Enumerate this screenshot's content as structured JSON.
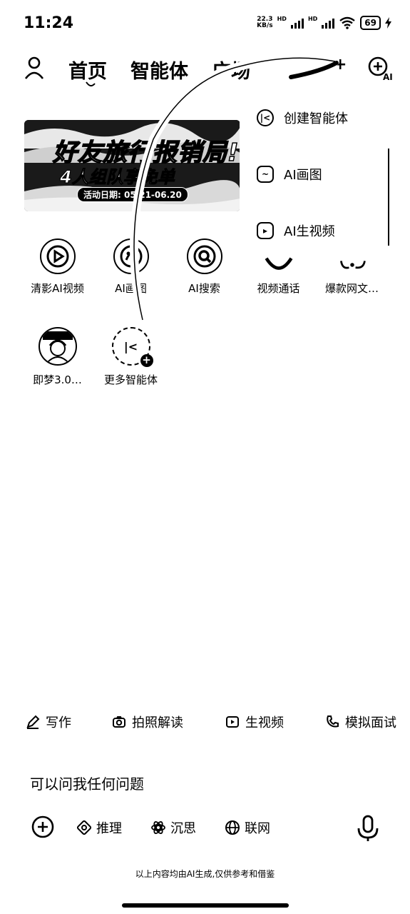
{
  "status": {
    "time": "11:24",
    "net_speed_value": "22.3",
    "net_speed_unit": "KB/s",
    "hd_label": "HD",
    "battery": "69"
  },
  "nav": {
    "tabs": [
      "首页",
      "智能体",
      "广场"
    ],
    "plus": "+"
  },
  "banner": {
    "title": "好友旅行报销局!",
    "subtitle": "4人组队享免单",
    "date": "活动日期: 05.21-06.20"
  },
  "menu": {
    "items": [
      {
        "label": "创建智能体",
        "icon": "agent-create-icon"
      },
      {
        "label": "AI画图",
        "icon": "image-icon"
      },
      {
        "label": "AI生视频",
        "icon": "video-icon"
      }
    ]
  },
  "agents": [
    {
      "label": "清影AI视频",
      "icon": "play-icon"
    },
    {
      "label": "AI画图",
      "icon": "paint-icon"
    },
    {
      "label": "AI搜索",
      "icon": "search-icon"
    },
    {
      "label": "视频通话",
      "icon": "video-call-icon"
    },
    {
      "label": "爆款网文…",
      "icon": "book-icon"
    },
    {
      "label": "即梦3.0…",
      "icon": "avatar-icon"
    },
    {
      "label": "更多智能体",
      "icon": "more-agents-icon"
    }
  ],
  "chips": [
    {
      "label": "写作",
      "icon": "pen-icon"
    },
    {
      "label": "拍照解读",
      "icon": "camera-icon"
    },
    {
      "label": "生视频",
      "icon": "video-icon"
    },
    {
      "label": "模拟面试",
      "icon": "phone-icon"
    }
  ],
  "input": {
    "placeholder": "可以问我任何问题",
    "tools": [
      {
        "label": "推理",
        "icon": "reasoning-icon"
      },
      {
        "label": "沉思",
        "icon": "think-icon"
      },
      {
        "label": "联网",
        "icon": "globe-icon"
      }
    ]
  },
  "disclaimer": "以上内容均由AI生成,仅供参考和借鉴",
  "colors": {
    "background": "#ffffff",
    "foreground": "#000000"
  }
}
